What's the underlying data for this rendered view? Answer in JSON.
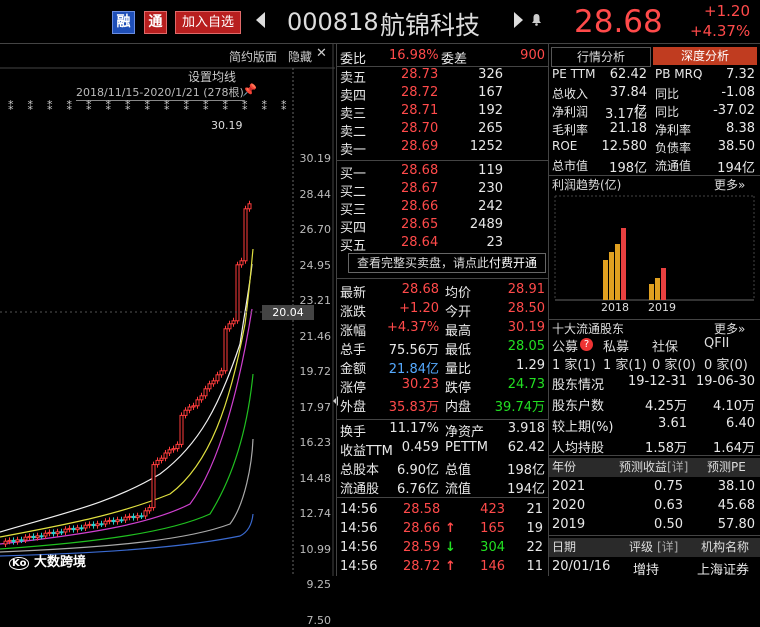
{
  "header": {
    "rong_label": "融",
    "tong_label": "通",
    "add_fav_label": "加入自选",
    "code": "000818",
    "name": "航锦科技",
    "price": "28.68",
    "change": "+1.20",
    "change_pct": "+4.37%"
  },
  "chart": {
    "simple_btn": "简约版面",
    "hide_btn": "隐藏",
    "ma_setting": "设置均线",
    "range_label": "2018/11/15-2020/1/21 (278根)",
    "high_label": "30.19",
    "cursor_price": "20.04",
    "watermark": "大数跨境",
    "y_ticks": [
      "30.19",
      "28.44",
      "26.70",
      "24.95",
      "23.21",
      "21.46",
      "19.72",
      "17.97",
      "16.23",
      "14.48",
      "12.74",
      "10.99",
      "9.25",
      "7.50"
    ]
  },
  "orderbook": {
    "ratio_label": "委比",
    "ratio_value": "16.98%",
    "diff_label": "委差",
    "diff_value": "900",
    "asks": [
      {
        "label": "卖五",
        "price": "28.73",
        "vol": "326"
      },
      {
        "label": "卖四",
        "price": "28.72",
        "vol": "167"
      },
      {
        "label": "卖三",
        "price": "28.71",
        "vol": "192"
      },
      {
        "label": "卖二",
        "price": "28.70",
        "vol": "265"
      },
      {
        "label": "卖一",
        "price": "28.69",
        "vol": "1252"
      }
    ],
    "bids": [
      {
        "label": "买一",
        "price": "28.68",
        "vol": "119"
      },
      {
        "label": "买二",
        "price": "28.67",
        "vol": "230"
      },
      {
        "label": "买三",
        "price": "28.66",
        "vol": "242"
      },
      {
        "label": "买四",
        "price": "28.65",
        "vol": "2489"
      },
      {
        "label": "买五",
        "price": "28.64",
        "vol": "23"
      }
    ],
    "full_book_text": "查看完整买卖盘，请点此",
    "paid_text": "付费开通"
  },
  "quote": {
    "r1": {
      "l1": "最新",
      "v1": "28.68",
      "l2": "均价",
      "v2": "28.91"
    },
    "r2": {
      "l1": "涨跌",
      "v1": "+1.20",
      "l2": "今开",
      "v2": "28.50"
    },
    "r3": {
      "l1": "涨幅",
      "v1": "+4.37%",
      "l2": "最高",
      "v2": "30.19"
    },
    "r4": {
      "l1": "总手",
      "v1": "75.56万",
      "l2": "最低",
      "v2": "28.05"
    },
    "r5": {
      "l1": "金额",
      "v1": "21.84亿",
      "l2": "量比",
      "v2": "1.29"
    },
    "r6": {
      "l1": "涨停",
      "v1": "30.23",
      "l2": "跌停",
      "v2": "24.73"
    },
    "r7": {
      "l1": "外盘",
      "v1": "35.83万",
      "l2": "内盘",
      "v2": "39.74万"
    },
    "r8": {
      "l1": "换手",
      "v1": "11.17%",
      "l2": "净资产",
      "v2": "3.918"
    },
    "r9": {
      "l1": "收益TTM",
      "v1": "0.459",
      "l2": "PETTM",
      "v2": "62.42"
    },
    "r10": {
      "l1": "总股本",
      "v1": "6.90亿",
      "l2": "总值",
      "v2": "198亿"
    },
    "r11": {
      "l1": "流通股",
      "v1": "6.76亿",
      "l2": "流值",
      "v2": "194亿"
    }
  },
  "ticks": [
    {
      "time": "14:56",
      "price": "28.58",
      "arrow": "",
      "vol": "423",
      "n": "21"
    },
    {
      "time": "14:56",
      "price": "28.66",
      "arrow": "↑",
      "vol": "165",
      "n": "19"
    },
    {
      "time": "14:56",
      "price": "28.59",
      "arrow": "↓",
      "vol": "304",
      "n": "22"
    },
    {
      "time": "14:56",
      "price": "28.72",
      "arrow": "↑",
      "vol": "146",
      "n": "11"
    }
  ],
  "right": {
    "tab1": "行情分析",
    "tab2": "深度分析",
    "f1": {
      "l1": "PE TTM",
      "v1": "62.42",
      "l2": "PB MRQ",
      "v2": "7.32"
    },
    "f2": {
      "l1": "总收入",
      "v1": "37.84亿",
      "l2": "同比",
      "v2": "-1.08"
    },
    "f3": {
      "l1": "净利润",
      "v1": "3.17亿",
      "l2": "同比",
      "v2": "-37.02"
    },
    "f4": {
      "l1": "毛利率",
      "v1": "21.18",
      "l2": "净利率",
      "v2": "8.38"
    },
    "f5": {
      "l1": "ROE",
      "v1": "12.580",
      "l2": "负债率",
      "v2": "38.50"
    },
    "f6": {
      "l1": "总市值",
      "v1": "198亿",
      "l2": "流通值",
      "v2": "194亿"
    },
    "profit_title": "利润趋势(亿)",
    "more1": "更多»",
    "years": [
      "2018",
      "2019"
    ],
    "holders_title": "十大流通股东",
    "more2": "更多»",
    "holder_types": [
      "公募",
      "私募",
      "社保",
      "QFII"
    ],
    "holder_counts": [
      "1 家(1)",
      "1 家(1)",
      "0 家(0)",
      "0 家(0)"
    ],
    "h1": {
      "l": "股东情况",
      "v1": "19-12-31",
      "v2": "19-06-30"
    },
    "h2": {
      "l": "股东户数",
      "v1": "4.25万",
      "v2": "4.10万"
    },
    "h3": {
      "l": "较上期(%)",
      "v1": "3.61",
      "v2": "6.40"
    },
    "h4": {
      "l": "人均持股",
      "v1": "1.58万",
      "v2": "1.64万"
    },
    "fc_head": {
      "c1": "年份",
      "c2": "预测收益",
      "tag": "[详]",
      "c3": "预测PE"
    },
    "fc": [
      {
        "year": "2021",
        "eps": "0.75",
        "pe": "38.10"
      },
      {
        "year": "2020",
        "eps": "0.63",
        "pe": "45.68"
      },
      {
        "year": "2019",
        "eps": "0.50",
        "pe": "57.80"
      }
    ],
    "rate_head": {
      "c1": "日期",
      "c2": "评级",
      "tag": "[详]",
      "c3": "机构名称"
    },
    "rate": {
      "date": "20/01/16",
      "grade": "增持",
      "org": "上海证券"
    }
  }
}
